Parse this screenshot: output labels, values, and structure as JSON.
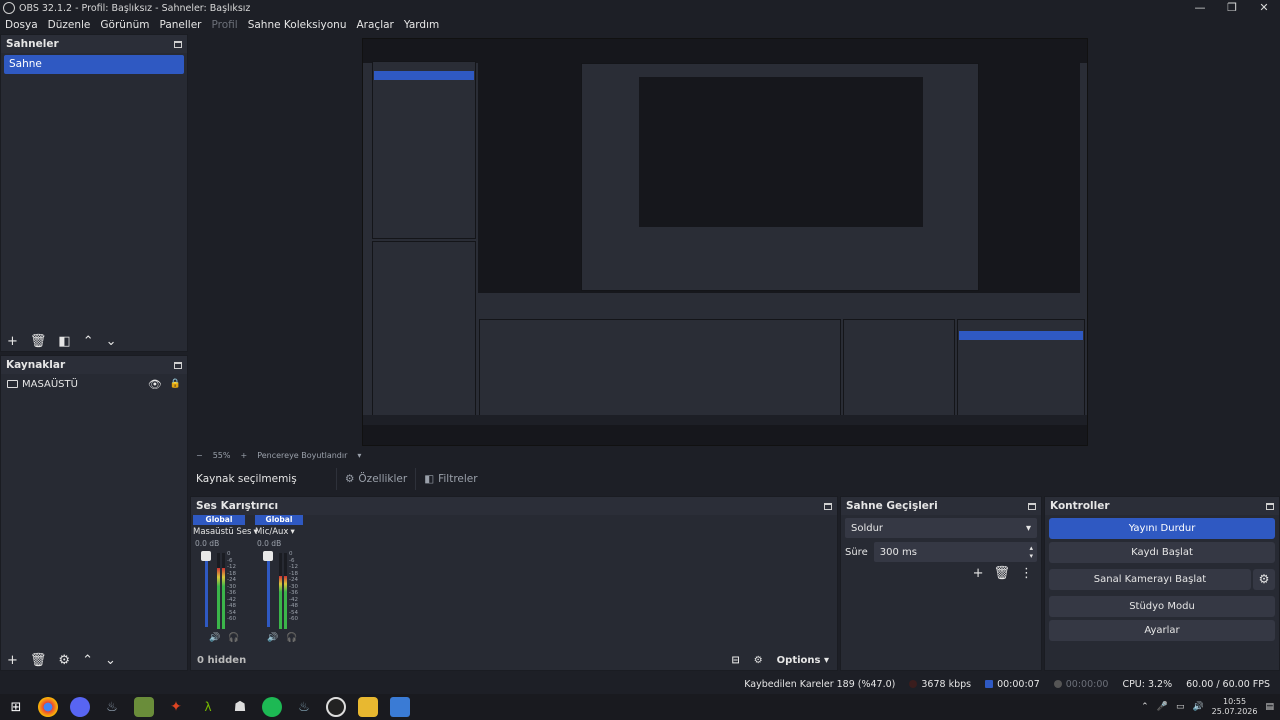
{
  "window": {
    "title": "OBS 32.1.2 - Profil: Başlıksız - Sahneler: Başlıksız",
    "minimize": "—",
    "maximize": "❐",
    "close": "✕"
  },
  "menu": [
    "Dosya",
    "Düzenle",
    "Görünüm",
    "Paneller",
    "Profil",
    "Sahne Koleksiyonu",
    "Araçlar",
    "Yardım"
  ],
  "scenes": {
    "title": "Sahneler",
    "items": [
      "Sahne"
    ]
  },
  "sources": {
    "title": "Kaynaklar",
    "items": [
      "MASAÜSTÜ"
    ]
  },
  "preview": {
    "zoom": "55%",
    "fit_label": "Pencereye Boyutlandır"
  },
  "source_toolbar": {
    "no_selection": "Kaynak seçilmemiş",
    "properties": "Özellikler",
    "filters": "Filtreler"
  },
  "mixer": {
    "title": "Ses Karıştırıcı",
    "channels": [
      {
        "scope": "Global",
        "name": "Masaüstü Ses",
        "db": "0.0 dB",
        "level": 0.8
      },
      {
        "scope": "Global",
        "name": "Mic/Aux",
        "db": "0.0 dB",
        "level": 0.7
      }
    ],
    "scale": [
      "0",
      "-6",
      "-12",
      "-18",
      "-24",
      "-30",
      "-36",
      "-42",
      "-48",
      "-54",
      "-60"
    ],
    "hidden": "0 hidden",
    "options": "Options"
  },
  "transitions": {
    "title": "Sahne Geçişleri",
    "selected": "Soldur",
    "duration_label": "Süre",
    "duration": "300 ms"
  },
  "controls": {
    "title": "Kontroller",
    "stop_stream": "Yayını Durdur",
    "start_record": "Kaydı Başlat",
    "start_virtualcam": "Sanal Kamerayı Başlat",
    "studio_mode": "Stüdyo Modu",
    "settings": "Ayarlar"
  },
  "status": {
    "dropped": "Kaybedilen Kareler 189 (%47.0)",
    "bitrate": "3678 kbps",
    "stream_time": "00:00:07",
    "record_time": "00:00:00",
    "cpu": "CPU: 3.2%",
    "fps": "60.00 / 60.00 FPS"
  },
  "taskbar": {
    "time": "10:55",
    "date": "25.07.2026"
  },
  "colors": {
    "accent": "#2f59c2",
    "bg": "#1d1f26",
    "panel": "#272a33"
  }
}
